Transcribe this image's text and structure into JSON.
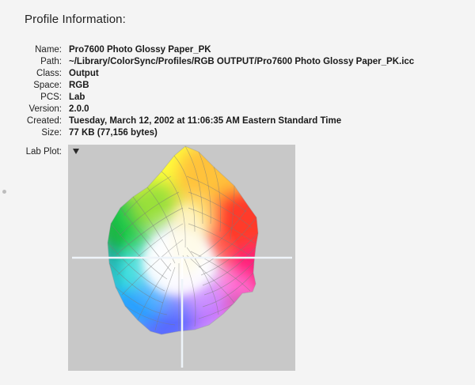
{
  "section_title": "Profile Information:",
  "info": [
    {
      "label": "Name:",
      "value": "Pro7600 Photo Glossy Paper_PK"
    },
    {
      "label": "Path:",
      "value": "~/Library/ColorSync/Profiles/RGB OUTPUT/Pro7600 Photo Glossy Paper_PK.icc"
    },
    {
      "label": "Class:",
      "value": "Output"
    },
    {
      "label": "Space:",
      "value": "RGB"
    },
    {
      "label": "PCS:",
      "value": "Lab"
    },
    {
      "label": "Version:",
      "value": "2.0.0"
    },
    {
      "label": "Created:",
      "value": "Tuesday, March 12, 2002 at 11:06:35 AM Eastern Standard Time"
    },
    {
      "label": "Size:",
      "value": "77 KB (77,156 bytes)"
    }
  ],
  "lab_plot": {
    "label": "Lab Plot:",
    "expanded": true,
    "background_color": "#c8c8c8",
    "axis_color": "#eef4fa"
  },
  "icons": {
    "disclosure": "disclosure-triangle-icon"
  }
}
